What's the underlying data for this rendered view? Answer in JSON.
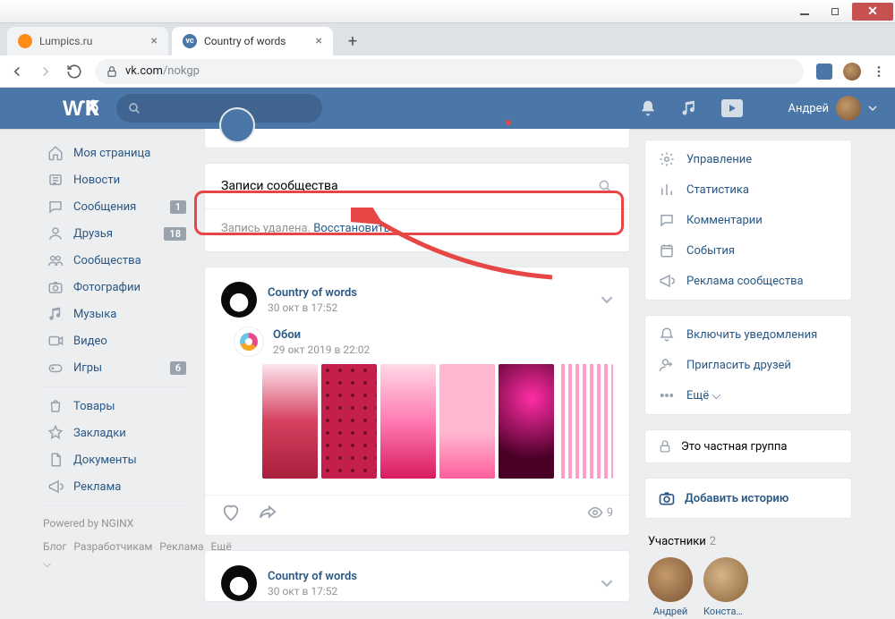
{
  "browser": {
    "tabs": [
      {
        "title": "Lumpics.ru"
      },
      {
        "title": "Country of words"
      }
    ],
    "url_host": "vk.com",
    "url_path": "/nokgp"
  },
  "header": {
    "username": "Андрей"
  },
  "left_nav": {
    "items": [
      {
        "icon": "home",
        "label": "Моя страница",
        "badge": null
      },
      {
        "icon": "news",
        "label": "Новости",
        "badge": null
      },
      {
        "icon": "msg",
        "label": "Сообщения",
        "badge": "1"
      },
      {
        "icon": "friends",
        "label": "Друзья",
        "badge": "18"
      },
      {
        "icon": "groups",
        "label": "Сообщества",
        "badge": null
      },
      {
        "icon": "photo",
        "label": "Фотографии",
        "badge": null
      },
      {
        "icon": "music",
        "label": "Музыка",
        "badge": null
      },
      {
        "icon": "video",
        "label": "Видео",
        "badge": null
      },
      {
        "icon": "game",
        "label": "Игры",
        "badge": "6"
      }
    ],
    "items2": [
      {
        "icon": "shop",
        "label": "Товары"
      },
      {
        "icon": "bookmark",
        "label": "Закладки"
      },
      {
        "icon": "doc",
        "label": "Документы"
      },
      {
        "icon": "ads",
        "label": "Реклама"
      }
    ],
    "powered": "Powered by NGINX",
    "footer": [
      "Блог",
      "Разработчикам",
      "Реклама",
      "Ещё ⌵"
    ]
  },
  "wall": {
    "header": "Записи сообщества",
    "deleted_text": "Запись удалена.",
    "restore_link": "Восстановить",
    "post": {
      "author": "Country of words",
      "date": "30 окт в 17:52",
      "repost_author": "Обои",
      "repost_date": "29 окт 2019 в 22:02",
      "views": "9"
    },
    "next_post_author": "Country of words",
    "next_post_date": "30 окт в 17:52"
  },
  "right": {
    "menu1": [
      {
        "icon": "gear",
        "label": "Управление"
      },
      {
        "icon": "stats",
        "label": "Статистика"
      },
      {
        "icon": "comment",
        "label": "Комментарии"
      },
      {
        "icon": "calendar",
        "label": "События"
      },
      {
        "icon": "megaphone",
        "label": "Реклама сообщества"
      }
    ],
    "menu2": [
      {
        "icon": "bell",
        "label": "Включить уведомления"
      },
      {
        "icon": "invite",
        "label": "Пригласить друзей"
      },
      {
        "icon": "more",
        "label": "Ещё ⌵"
      }
    ],
    "private": "Это частная группа",
    "story": "Добавить историю",
    "members_title": "Участники",
    "members_count": "2",
    "members": [
      "Андрей",
      "Константин"
    ]
  }
}
